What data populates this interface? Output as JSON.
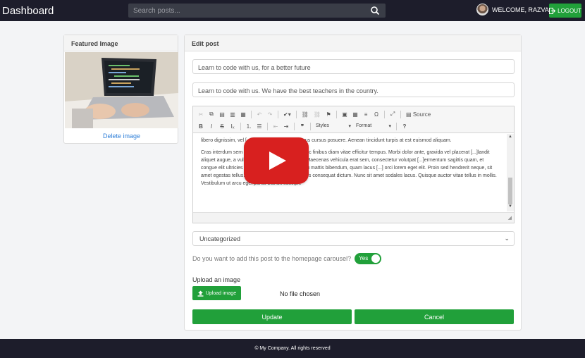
{
  "navbar": {
    "brand": "Dashboard",
    "search_placeholder": "Search posts...",
    "welcome": "WELCOME, RAZVAN",
    "logout": "LOGOUT"
  },
  "featured": {
    "title": "Featured Image",
    "delete_label": "Delete image"
  },
  "edit": {
    "title": "Edit post",
    "post_title": "Learn to code with us, for a better future",
    "post_subtitle": "Learn to code with us. We have the best teachers in the country.",
    "toolbar": {
      "row1": [
        "cut",
        "copy",
        "paste",
        "paste-text",
        "paste-word",
        "undo",
        "redo",
        "spellcheck",
        "link",
        "unlink",
        "anchor",
        "image",
        "table",
        "horizontal-rule",
        "special-char",
        "maximize"
      ],
      "source_label": "Source",
      "styles_label": "Styles",
      "format_label": "Format",
      "bold": "B",
      "italic": "I",
      "strike": "S",
      "help": "?"
    },
    "content": {
      "p1": "libero dignissim, vel [...]uris cursus ante non purus cursus posuere. Aenean tincidunt turpis at est euismod aliquam.",
      "p2": "Cras interdum sem [...]suada risus maximus. Nunc finibus diam vitae efficitur tempus. Morbi dolor ante, gravida vel placerat [...]landit aliquet augue, a vulputate arcu laoreet moncus. Maecenas vehicula erat sem, consectetur volutpat [...]ermentum sagittis quam, et congue elit ultricies eu. Duis bibendum, massa eu mattis bibendum, quam lacus [...] orci lorem eget elit. Proin sed hendrerit neque, sit amet egestas tellus. Nullam sollicitudin augue quis consequat dictum. Nunc sit amet sodales lacus. Quisque auctor vitae tellus in mollis. Vestibulum ut arcu eget purus blandit suscipit."
    },
    "category": "Uncategorized",
    "carousel_question": "Do you want to add this post to the homepage carousel?",
    "carousel_toggle": "Yes",
    "upload_label": "Upload an image",
    "upload_button": "Upload image",
    "file_status": "No file chosen",
    "update": "Update",
    "cancel": "Cancel"
  },
  "footer": {
    "text": "© My Company. All rights reserved"
  },
  "colors": {
    "navbar": "#1d1d2b",
    "accent_green": "#21a03a",
    "link_blue": "#2f7fd8",
    "play_red": "#d8201f"
  }
}
